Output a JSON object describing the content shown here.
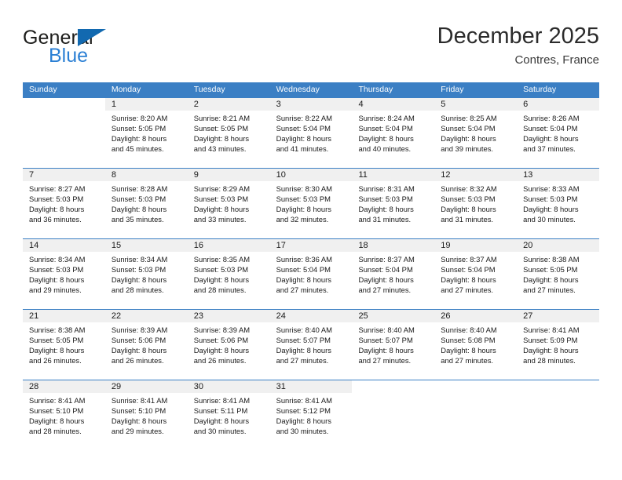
{
  "brand": {
    "name_part1": "General",
    "name_part2": "Blue",
    "logo_icon": "triangle-flag-icon"
  },
  "header": {
    "title": "December 2025",
    "location": "Contres, France"
  },
  "weekdays": [
    "Sunday",
    "Monday",
    "Tuesday",
    "Wednesday",
    "Thursday",
    "Friday",
    "Saturday"
  ],
  "colors": {
    "header_blue": "#3b7fc4",
    "brand_blue": "#2a7fd4",
    "logo_blue": "#1269b0",
    "day_strip_gray": "#f0f0f0",
    "text": "#1a1a1a"
  },
  "weeks": [
    [
      {
        "day": "",
        "sunrise": "",
        "sunset": "",
        "daylight_line1": "",
        "daylight_line2": ""
      },
      {
        "day": "1",
        "sunrise": "Sunrise: 8:20 AM",
        "sunset": "Sunset: 5:05 PM",
        "daylight_line1": "Daylight: 8 hours",
        "daylight_line2": "and 45 minutes."
      },
      {
        "day": "2",
        "sunrise": "Sunrise: 8:21 AM",
        "sunset": "Sunset: 5:05 PM",
        "daylight_line1": "Daylight: 8 hours",
        "daylight_line2": "and 43 minutes."
      },
      {
        "day": "3",
        "sunrise": "Sunrise: 8:22 AM",
        "sunset": "Sunset: 5:04 PM",
        "daylight_line1": "Daylight: 8 hours",
        "daylight_line2": "and 41 minutes."
      },
      {
        "day": "4",
        "sunrise": "Sunrise: 8:24 AM",
        "sunset": "Sunset: 5:04 PM",
        "daylight_line1": "Daylight: 8 hours",
        "daylight_line2": "and 40 minutes."
      },
      {
        "day": "5",
        "sunrise": "Sunrise: 8:25 AM",
        "sunset": "Sunset: 5:04 PM",
        "daylight_line1": "Daylight: 8 hours",
        "daylight_line2": "and 39 minutes."
      },
      {
        "day": "6",
        "sunrise": "Sunrise: 8:26 AM",
        "sunset": "Sunset: 5:04 PM",
        "daylight_line1": "Daylight: 8 hours",
        "daylight_line2": "and 37 minutes."
      }
    ],
    [
      {
        "day": "7",
        "sunrise": "Sunrise: 8:27 AM",
        "sunset": "Sunset: 5:03 PM",
        "daylight_line1": "Daylight: 8 hours",
        "daylight_line2": "and 36 minutes."
      },
      {
        "day": "8",
        "sunrise": "Sunrise: 8:28 AM",
        "sunset": "Sunset: 5:03 PM",
        "daylight_line1": "Daylight: 8 hours",
        "daylight_line2": "and 35 minutes."
      },
      {
        "day": "9",
        "sunrise": "Sunrise: 8:29 AM",
        "sunset": "Sunset: 5:03 PM",
        "daylight_line1": "Daylight: 8 hours",
        "daylight_line2": "and 33 minutes."
      },
      {
        "day": "10",
        "sunrise": "Sunrise: 8:30 AM",
        "sunset": "Sunset: 5:03 PM",
        "daylight_line1": "Daylight: 8 hours",
        "daylight_line2": "and 32 minutes."
      },
      {
        "day": "11",
        "sunrise": "Sunrise: 8:31 AM",
        "sunset": "Sunset: 5:03 PM",
        "daylight_line1": "Daylight: 8 hours",
        "daylight_line2": "and 31 minutes."
      },
      {
        "day": "12",
        "sunrise": "Sunrise: 8:32 AM",
        "sunset": "Sunset: 5:03 PM",
        "daylight_line1": "Daylight: 8 hours",
        "daylight_line2": "and 31 minutes."
      },
      {
        "day": "13",
        "sunrise": "Sunrise: 8:33 AM",
        "sunset": "Sunset: 5:03 PM",
        "daylight_line1": "Daylight: 8 hours",
        "daylight_line2": "and 30 minutes."
      }
    ],
    [
      {
        "day": "14",
        "sunrise": "Sunrise: 8:34 AM",
        "sunset": "Sunset: 5:03 PM",
        "daylight_line1": "Daylight: 8 hours",
        "daylight_line2": "and 29 minutes."
      },
      {
        "day": "15",
        "sunrise": "Sunrise: 8:34 AM",
        "sunset": "Sunset: 5:03 PM",
        "daylight_line1": "Daylight: 8 hours",
        "daylight_line2": "and 28 minutes."
      },
      {
        "day": "16",
        "sunrise": "Sunrise: 8:35 AM",
        "sunset": "Sunset: 5:03 PM",
        "daylight_line1": "Daylight: 8 hours",
        "daylight_line2": "and 28 minutes."
      },
      {
        "day": "17",
        "sunrise": "Sunrise: 8:36 AM",
        "sunset": "Sunset: 5:04 PM",
        "daylight_line1": "Daylight: 8 hours",
        "daylight_line2": "and 27 minutes."
      },
      {
        "day": "18",
        "sunrise": "Sunrise: 8:37 AM",
        "sunset": "Sunset: 5:04 PM",
        "daylight_line1": "Daylight: 8 hours",
        "daylight_line2": "and 27 minutes."
      },
      {
        "day": "19",
        "sunrise": "Sunrise: 8:37 AM",
        "sunset": "Sunset: 5:04 PM",
        "daylight_line1": "Daylight: 8 hours",
        "daylight_line2": "and 27 minutes."
      },
      {
        "day": "20",
        "sunrise": "Sunrise: 8:38 AM",
        "sunset": "Sunset: 5:05 PM",
        "daylight_line1": "Daylight: 8 hours",
        "daylight_line2": "and 27 minutes."
      }
    ],
    [
      {
        "day": "21",
        "sunrise": "Sunrise: 8:38 AM",
        "sunset": "Sunset: 5:05 PM",
        "daylight_line1": "Daylight: 8 hours",
        "daylight_line2": "and 26 minutes."
      },
      {
        "day": "22",
        "sunrise": "Sunrise: 8:39 AM",
        "sunset": "Sunset: 5:06 PM",
        "daylight_line1": "Daylight: 8 hours",
        "daylight_line2": "and 26 minutes."
      },
      {
        "day": "23",
        "sunrise": "Sunrise: 8:39 AM",
        "sunset": "Sunset: 5:06 PM",
        "daylight_line1": "Daylight: 8 hours",
        "daylight_line2": "and 26 minutes."
      },
      {
        "day": "24",
        "sunrise": "Sunrise: 8:40 AM",
        "sunset": "Sunset: 5:07 PM",
        "daylight_line1": "Daylight: 8 hours",
        "daylight_line2": "and 27 minutes."
      },
      {
        "day": "25",
        "sunrise": "Sunrise: 8:40 AM",
        "sunset": "Sunset: 5:07 PM",
        "daylight_line1": "Daylight: 8 hours",
        "daylight_line2": "and 27 minutes."
      },
      {
        "day": "26",
        "sunrise": "Sunrise: 8:40 AM",
        "sunset": "Sunset: 5:08 PM",
        "daylight_line1": "Daylight: 8 hours",
        "daylight_line2": "and 27 minutes."
      },
      {
        "day": "27",
        "sunrise": "Sunrise: 8:41 AM",
        "sunset": "Sunset: 5:09 PM",
        "daylight_line1": "Daylight: 8 hours",
        "daylight_line2": "and 28 minutes."
      }
    ],
    [
      {
        "day": "28",
        "sunrise": "Sunrise: 8:41 AM",
        "sunset": "Sunset: 5:10 PM",
        "daylight_line1": "Daylight: 8 hours",
        "daylight_line2": "and 28 minutes."
      },
      {
        "day": "29",
        "sunrise": "Sunrise: 8:41 AM",
        "sunset": "Sunset: 5:10 PM",
        "daylight_line1": "Daylight: 8 hours",
        "daylight_line2": "and 29 minutes."
      },
      {
        "day": "30",
        "sunrise": "Sunrise: 8:41 AM",
        "sunset": "Sunset: 5:11 PM",
        "daylight_line1": "Daylight: 8 hours",
        "daylight_line2": "and 30 minutes."
      },
      {
        "day": "31",
        "sunrise": "Sunrise: 8:41 AM",
        "sunset": "Sunset: 5:12 PM",
        "daylight_line1": "Daylight: 8 hours",
        "daylight_line2": "and 30 minutes."
      },
      {
        "day": "",
        "sunrise": "",
        "sunset": "",
        "daylight_line1": "",
        "daylight_line2": ""
      },
      {
        "day": "",
        "sunrise": "",
        "sunset": "",
        "daylight_line1": "",
        "daylight_line2": ""
      },
      {
        "day": "",
        "sunrise": "",
        "sunset": "",
        "daylight_line1": "",
        "daylight_line2": ""
      }
    ]
  ]
}
